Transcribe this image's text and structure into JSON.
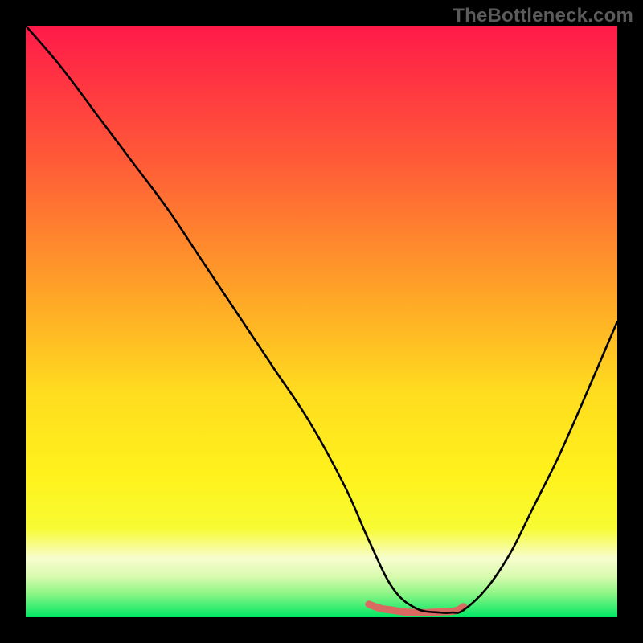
{
  "watermark": "TheBottleneck.com",
  "chart_data": {
    "type": "line",
    "title": "",
    "xlabel": "",
    "ylabel": "",
    "xlim": [
      0,
      100
    ],
    "ylim": [
      0,
      100
    ],
    "series": [
      {
        "name": "curve",
        "x": [
          0,
          6,
          12,
          18,
          24,
          30,
          36,
          42,
          48,
          54,
          58,
          62,
          66,
          70,
          72,
          74,
          78,
          82,
          86,
          90,
          94,
          100
        ],
        "y": [
          100,
          93,
          85,
          77,
          69,
          60,
          51,
          42,
          33,
          22,
          13,
          5,
          1.5,
          0.8,
          0.8,
          1.2,
          5,
          11,
          19,
          27,
          36,
          50
        ]
      },
      {
        "name": "trough-marker",
        "x": [
          58,
          60,
          62,
          64,
          66,
          68,
          70,
          72,
          73,
          74
        ],
        "y": [
          2.2,
          1.5,
          1.2,
          0.9,
          0.8,
          0.8,
          0.9,
          1.0,
          1.2,
          1.8
        ]
      }
    ],
    "background": {
      "type": "vertical-gradient",
      "stops": [
        {
          "offset": 0.0,
          "color": "#ff1a49"
        },
        {
          "offset": 0.22,
          "color": "#ff5838"
        },
        {
          "offset": 0.45,
          "color": "#ffa327"
        },
        {
          "offset": 0.62,
          "color": "#ffdc1f"
        },
        {
          "offset": 0.76,
          "color": "#fff21c"
        },
        {
          "offset": 0.85,
          "color": "#f7fb33"
        },
        {
          "offset": 0.9,
          "color": "#f7fdce"
        },
        {
          "offset": 0.93,
          "color": "#dafbb0"
        },
        {
          "offset": 0.96,
          "color": "#8df585"
        },
        {
          "offset": 1.0,
          "color": "#00e765"
        }
      ]
    },
    "trough_style": {
      "stroke": "#d86a62",
      "stroke_width": 9
    },
    "curve_style": {
      "stroke": "#000000",
      "stroke_width": 2.6
    }
  }
}
